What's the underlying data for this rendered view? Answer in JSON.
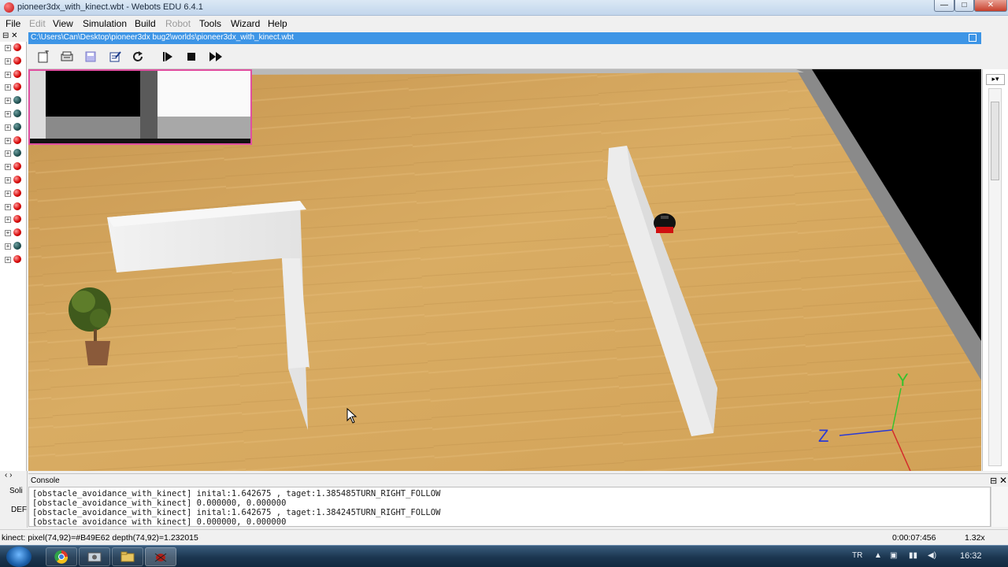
{
  "window": {
    "title": "pioneer3dx_with_kinect.wbt - Webots EDU 6.4.1",
    "controls": {
      "minimize": "—",
      "maximize": "□",
      "close": "✕"
    }
  },
  "menu": [
    {
      "label": "File",
      "enabled": true
    },
    {
      "label": "Edit",
      "enabled": false
    },
    {
      "label": "View",
      "enabled": true
    },
    {
      "label": "Simulation",
      "enabled": true
    },
    {
      "label": "Build",
      "enabled": true
    },
    {
      "label": "Robot",
      "enabled": false
    },
    {
      "label": "Tools",
      "enabled": true
    },
    {
      "label": "Wizard",
      "enabled": true
    },
    {
      "label": "Help",
      "enabled": true
    }
  ],
  "scene_tree": {
    "header": "⊟ ✕",
    "items": [
      "red",
      "red",
      "red",
      "red",
      "dark",
      "dark",
      "dark",
      "red",
      "dark",
      "red",
      "red",
      "red",
      "red",
      "red",
      "red",
      "dark",
      "red"
    ]
  },
  "view_window": {
    "path": "C:\\Users\\Can\\Desktop\\pioneer3dx bug2\\worlds\\pioneer3dx_with_kinect.wbt",
    "toolbar": {
      "new_icon": "new-world-icon",
      "open_icon": "open-icon",
      "save_icon": "save-icon",
      "edit_icon": "edit-icon",
      "reload_icon": "reload-icon",
      "run_icon": "step-icon",
      "stop_icon": "stop-icon",
      "fast_icon": "fast-forward-icon"
    }
  },
  "axes": {
    "y_label": "Y",
    "z_label": "Z"
  },
  "console": {
    "title": "Console",
    "lines": [
      "[obstacle_avoidance_with_kinect] inital:1.642675 , taget:1.385485TURN_RIGHT_FOLLOW",
      "[obstacle_avoidance_with_kinect] 0.000000, 0.000000",
      "[obstacle_avoidance_with_kinect] inital:1.642675 , taget:1.384245TURN_RIGHT_FOLLOW",
      "[obstacle_avoidance_with_kinect] 0.000000, 0.000000"
    ]
  },
  "left_bottom": {
    "tab1": "Soli",
    "tab2": "DEF",
    "arrows": "‹ ›"
  },
  "status": {
    "left": "kinect: pixel(74,92)=#B49E62 depth(74,92)=1.232015",
    "time": "0:00:07:456",
    "speed": "1.32x"
  },
  "taskbar": {
    "lang": "TR",
    "clock": "16:32"
  },
  "colors": {
    "titlebar_accent": "#3d95e6",
    "floor": "#d2a55a",
    "axis_y": "#35c22e",
    "axis_z": "#2a3ad6",
    "axis_x": "#d42b2b"
  }
}
